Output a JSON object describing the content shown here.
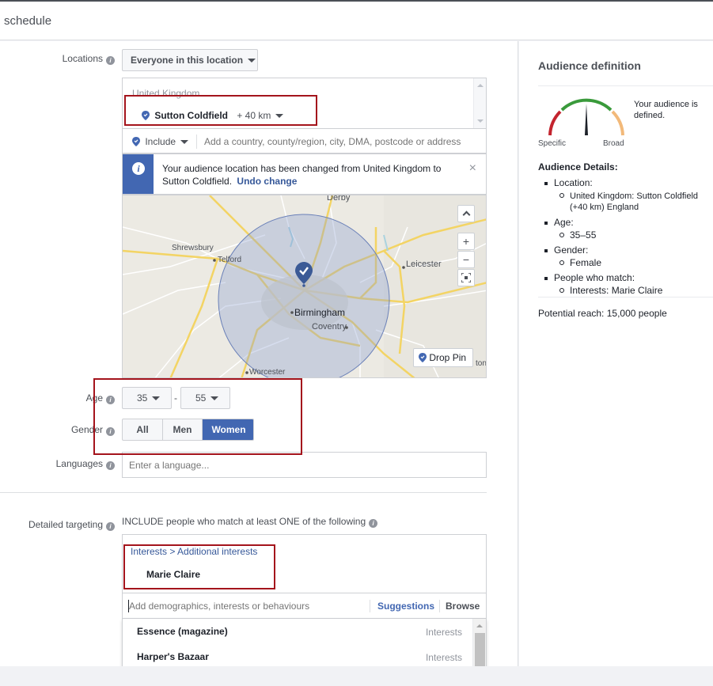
{
  "header": {
    "title": "schedule"
  },
  "locations": {
    "label": "Locations",
    "scope_dropdown": "Everyone in this location",
    "country": "United Kingdom",
    "selected_location": "Sutton Coldfield",
    "radius": "+ 40 km",
    "include_label": "Include",
    "search_placeholder": "Add a country, county/region, city, DMA, postcode or address",
    "notice_text": "Your audience location has been changed from United Kingdom to Sutton Coldfield.",
    "undo_label": "Undo change",
    "map": {
      "labels": [
        "Derby",
        "Shrewsbury",
        "Telford",
        "Leicester",
        "Birmingham",
        "Coventry",
        "Worcester",
        "ton"
      ],
      "drop_pin_label": "Drop Pin",
      "zoom_in": "+",
      "zoom_out": "−"
    }
  },
  "age": {
    "label": "Age",
    "min": "35",
    "max": "55",
    "separator": "-"
  },
  "gender": {
    "label": "Gender",
    "options": [
      "All",
      "Men",
      "Women"
    ],
    "selected": "Women"
  },
  "languages": {
    "label": "Languages",
    "placeholder": "Enter a language..."
  },
  "detailed_targeting": {
    "label": "Detailed targeting",
    "description": "INCLUDE people who match at least ONE of the following",
    "breadcrumb": "Interests > Additional interests",
    "selected_item": "Marie Claire",
    "search_placeholder": "Add demographics, interests or behaviours",
    "suggestions_label": "Suggestions",
    "browse_label": "Browse",
    "suggestions": [
      {
        "name": "Essence (magazine)",
        "category": "Interests"
      },
      {
        "name": "Harper's Bazaar",
        "category": "Interests"
      }
    ]
  },
  "audience": {
    "title": "Audience definition",
    "status": "Your audience is defined.",
    "gauge_left": "Specific",
    "gauge_right": "Broad",
    "details_title": "Audience Details:",
    "details": [
      {
        "heading": "Location:",
        "value": "United Kingdom: Sutton Coldfield (+40 km) England"
      },
      {
        "heading": "Age:",
        "value": "35–55"
      },
      {
        "heading": "Gender:",
        "value": "Female"
      },
      {
        "heading": "People who match:",
        "value": "Interests: Marie Claire"
      }
    ],
    "potential_reach": "Potential reach: 15,000 people"
  },
  "colors": {
    "accent": "#4267b2",
    "link": "#365899",
    "highlight": "#a4141c",
    "selected_button": "#4267b2"
  }
}
